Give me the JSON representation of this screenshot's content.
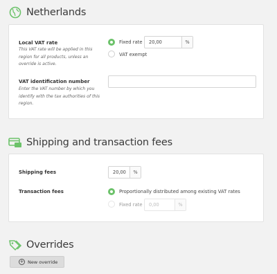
{
  "colors": {
    "accent": "#6cc26a",
    "background": "#f2f2f2",
    "card": "#ffffff"
  },
  "country": {
    "title": "Netherlands",
    "icon": "globe-icon",
    "local_vat_label": "Local VAT rate",
    "local_vat_desc": "This VAT rate will be applied in this region for all products, unless an override is active.",
    "fixed_rate_label": "Fixed rate",
    "fixed_rate_value": "20,00",
    "percent_unit": "%",
    "vat_exempt_label": "VAT exempt",
    "vat_id_label": "VAT identification number",
    "vat_id_desc": "Enter the VAT number by which you identify with the tax authorities of this region.",
    "vat_id_value": ""
  },
  "fees": {
    "title": "Shipping and transaction fees",
    "icon": "payment-card-icon",
    "shipping_label": "Shipping fees",
    "shipping_value": "20,00",
    "percent_unit": "%",
    "transaction_label": "Transaction fees",
    "proportional_label": "Proportionally distributed among existing VAT rates",
    "fixed_rate_label": "Fixed rate",
    "fixed_rate_value": "0,00",
    "fixed_unit": "%"
  },
  "overrides": {
    "title": "Overrides",
    "icon": "tags-icon",
    "new_button_label": "New override"
  }
}
